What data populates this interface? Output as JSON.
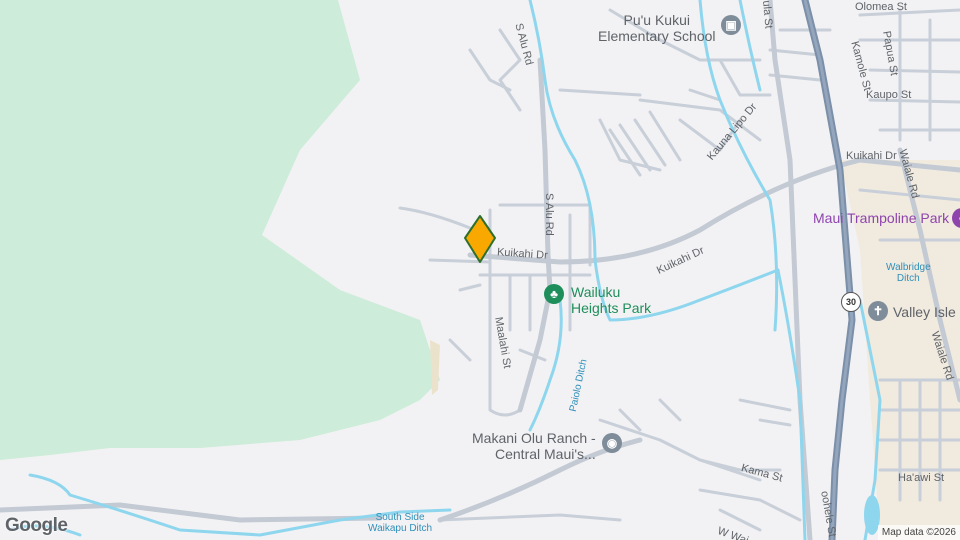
{
  "map": {
    "colors": {
      "land": "#f2f2f4",
      "forest": "#cdecd9",
      "road": "#ffffff",
      "road_edge": "#c6cdd6",
      "highway": "#7b8fa8",
      "water": "#8ed6ee",
      "park_green": "#1e8e5a",
      "marker": "#f9a800",
      "marker_edge": "#2f6f2c",
      "purple": "#8e44ad"
    },
    "streets": {
      "olomea": "Olomea St",
      "s_alu_top": "S Alu Rd",
      "s_alu_mid": "S Alu Rd",
      "kamole": "Kamole St",
      "papua": "Papua St",
      "kaupo": "Kaupo St",
      "kauna_lipo": "Kauna Lipo Dr",
      "kuikahi_right": "Kuikahi Dr",
      "waiale_top": "Waiale Rd",
      "kuikahi_left": "Kuikahi Dr",
      "kuikahi_mid": "Kuikahi Dr",
      "maalahi": "Maalahi St",
      "waiale_bottom": "Waiale Rd",
      "kama": "Kama St",
      "haawi": "Ha'awi St",
      "oohele": "oohele St",
      "w_wai": "W Wai",
      "ula": "ula St"
    },
    "water": {
      "paiolo": "Paiolo Ditch",
      "walbridge": "Walbridge\nDitch",
      "south_side": "South Side\nWaikapu Ditch"
    },
    "pois": {
      "school": "Pu'u Kukui\nElementary School",
      "park": "Wailuku\nHeights Park",
      "trampoline": "Maui Trampoline Park",
      "valley_isle": "Valley Isle",
      "ranch": "Makani Olu Ranch -\nCentral Maui's..."
    },
    "route_shield": "30",
    "icons": {
      "school": "school-icon",
      "park": "tree-icon",
      "church": "cross-icon",
      "ranch": "pin-icon",
      "trampoline": "activity-icon",
      "marker": "location-marker"
    },
    "branding": {
      "logo": "Google",
      "attribution": "Map data ©2026"
    }
  }
}
